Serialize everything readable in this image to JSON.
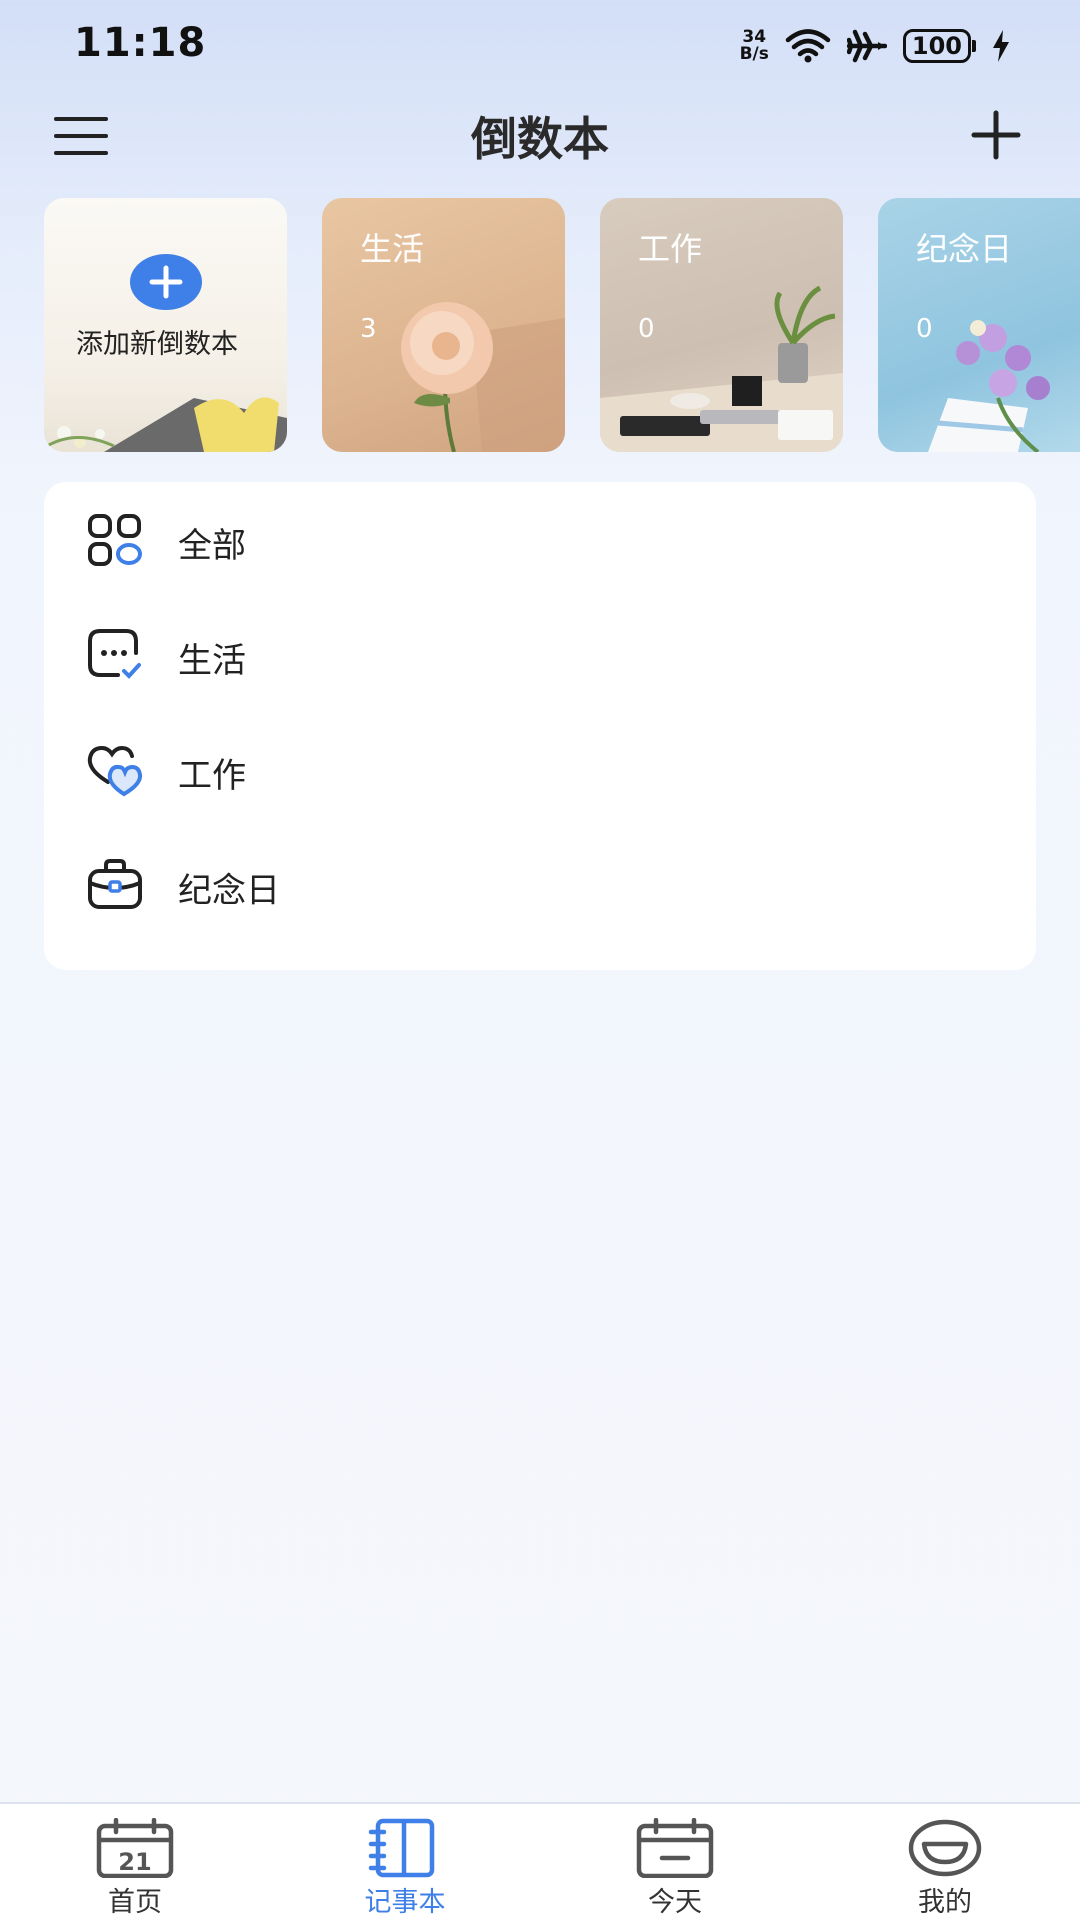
{
  "status_bar": {
    "time": "11:18",
    "net_speed_value": "34",
    "net_speed_unit": "B/s",
    "battery": "100",
    "icons": [
      "wifi-icon",
      "airplane-icon",
      "battery-icon",
      "charging-icon"
    ]
  },
  "header": {
    "title": "倒数本",
    "menu_icon": "hamburger-menu-icon",
    "add_icon": "plus-icon"
  },
  "cards": {
    "add_label": "添加新倒数本",
    "items": [
      {
        "label": "生活",
        "count": "3"
      },
      {
        "label": "工作",
        "count": "0"
      },
      {
        "label": "纪念日",
        "count": "0"
      }
    ]
  },
  "list": {
    "items": [
      {
        "label": "全部",
        "icon": "grid-apps-icon"
      },
      {
        "label": "生活",
        "icon": "chat-check-icon"
      },
      {
        "label": "工作",
        "icon": "hearts-icon"
      },
      {
        "label": "纪念日",
        "icon": "briefcase-icon"
      }
    ]
  },
  "bottom_nav": {
    "active": 1,
    "items": [
      {
        "label": "首页",
        "icon": "calendar-21-icon",
        "icon_text": "21"
      },
      {
        "label": "记事本",
        "icon": "notebook-icon"
      },
      {
        "label": "今天",
        "icon": "calendar-today-icon"
      },
      {
        "label": "我的",
        "icon": "smile-profile-icon"
      }
    ]
  },
  "colors": {
    "accent": "#3f7fe8",
    "text": "#222222",
    "nav_inactive": "#555555"
  }
}
